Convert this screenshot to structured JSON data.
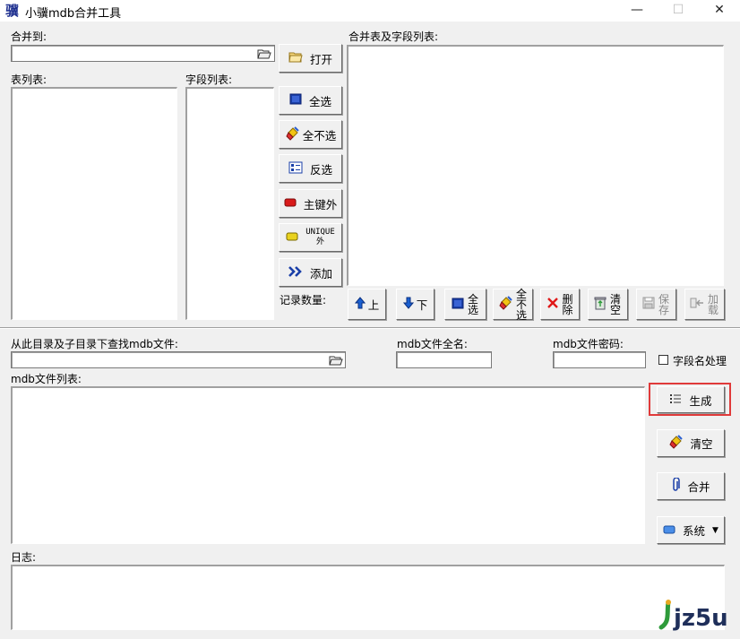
{
  "window": {
    "title": "小骥mdb合并工具",
    "app_icon_glyph": "骥",
    "controls": {
      "minimize": "—",
      "maximize": "☐",
      "close": "✕"
    }
  },
  "top": {
    "merge_to_label": "合并到:",
    "open_button": "打开",
    "table_list_label": "表列表:",
    "field_list_label": "字段列表:",
    "merge_fields_label": "合并表及字段列表:",
    "select_all": "全选",
    "deselect_all": "全不选",
    "invert": "反选",
    "except_pk": "主键外",
    "except_unique_line1": "UNIQUE",
    "except_unique_line2": "外",
    "add": "添加",
    "record_count_label": "记录数量:"
  },
  "action_bar": {
    "up": "上",
    "down": "下",
    "select_all": "全选",
    "deselect_all": "全不选",
    "delete": "删除",
    "clear": "清空",
    "save": "保存",
    "load": "加载"
  },
  "bottom": {
    "search_label": "从此目录及子目录下查找mdb文件:",
    "fullname_label": "mdb文件全名:",
    "password_label": "mdb文件密码:",
    "field_name_proc": "字段名处理",
    "mdb_list_label": "mdb文件列表:",
    "generate": "生成",
    "clear": "清空",
    "merge": "合并",
    "system": "系统",
    "log_label": "日志:"
  },
  "watermark": {
    "text": "jz5u"
  },
  "colors": {
    "accent_highlight": "#e03a3a",
    "icon_blue": "#1a3fa8",
    "watermark_green": "#2e9b3a"
  }
}
